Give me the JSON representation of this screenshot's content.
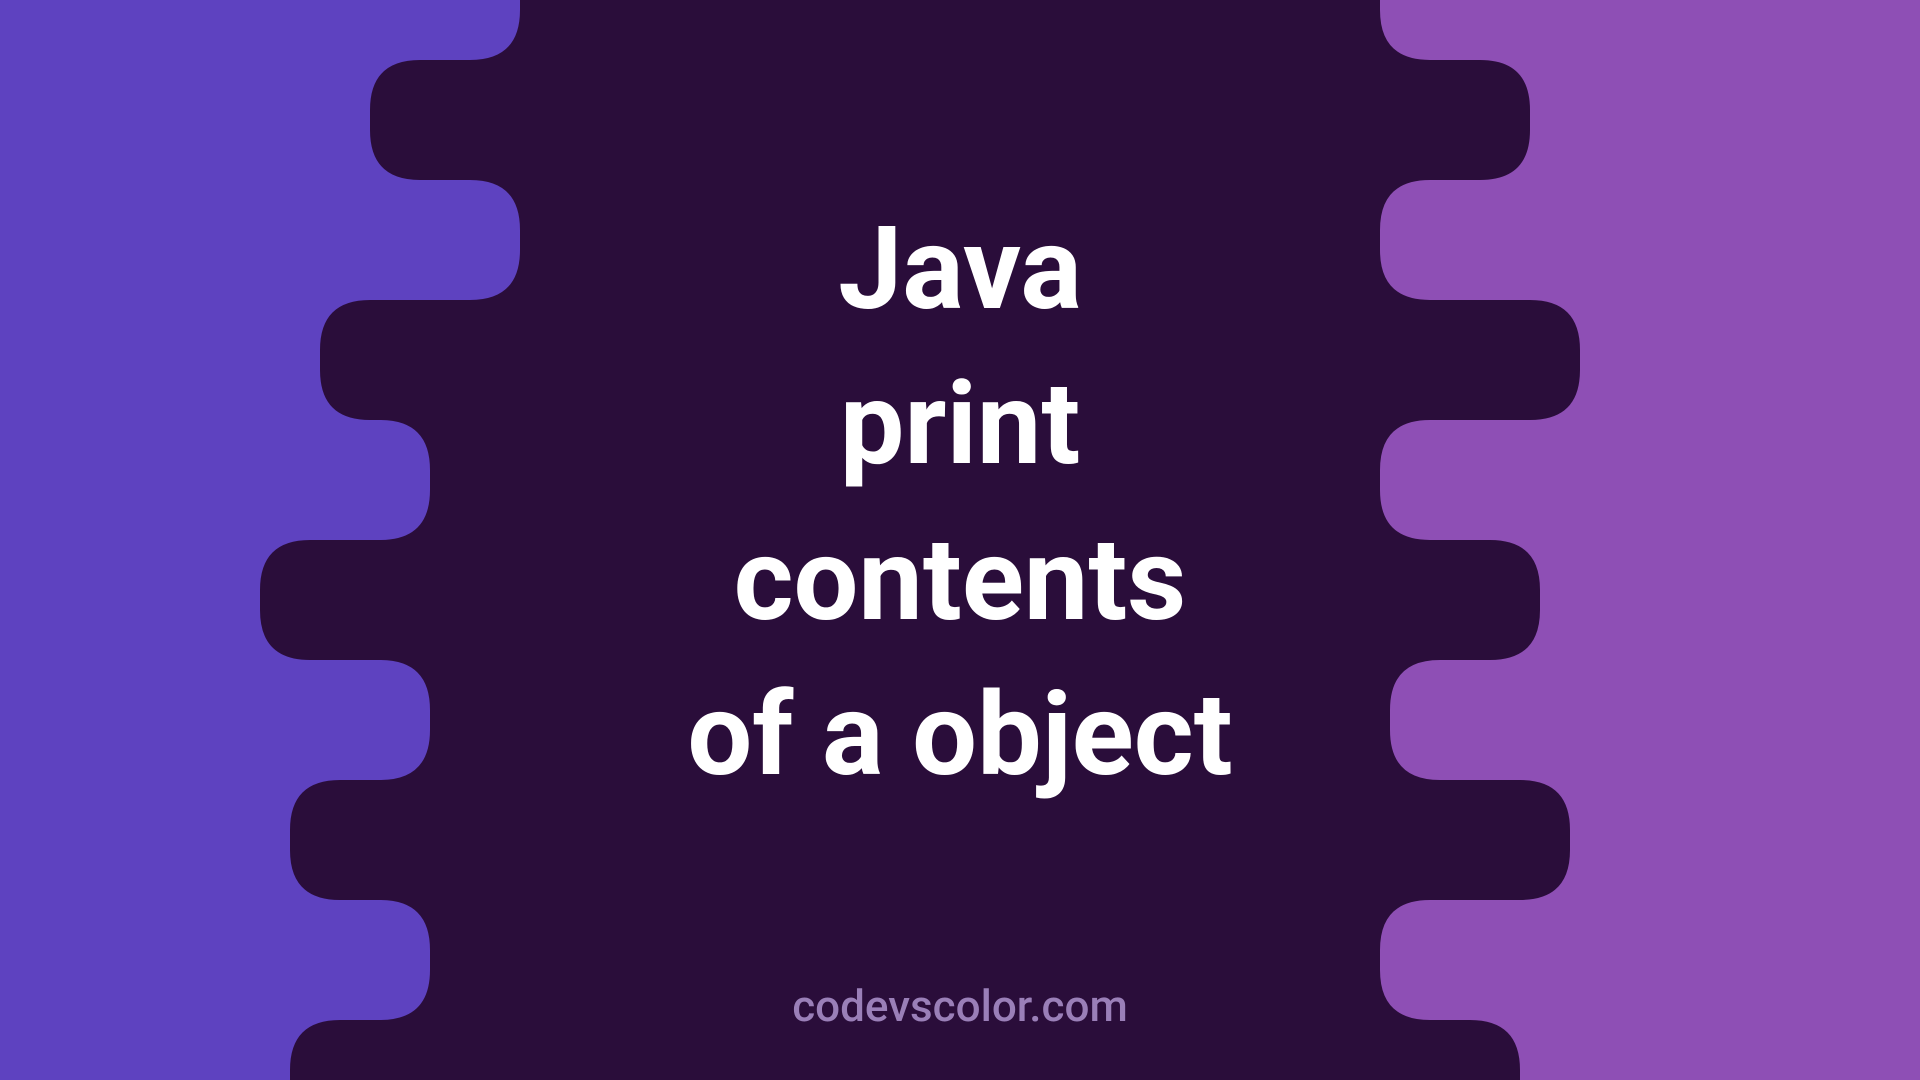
{
  "title": "Java\nprint\ncontents\nof a object",
  "watermark": "codevscolor.com",
  "colors": {
    "left_bg": "#5e42c0",
    "right_bg": "#8e4fb5",
    "blob": "#2a0d3a",
    "text": "#ffffff",
    "watermark": "#9a7fb8"
  }
}
